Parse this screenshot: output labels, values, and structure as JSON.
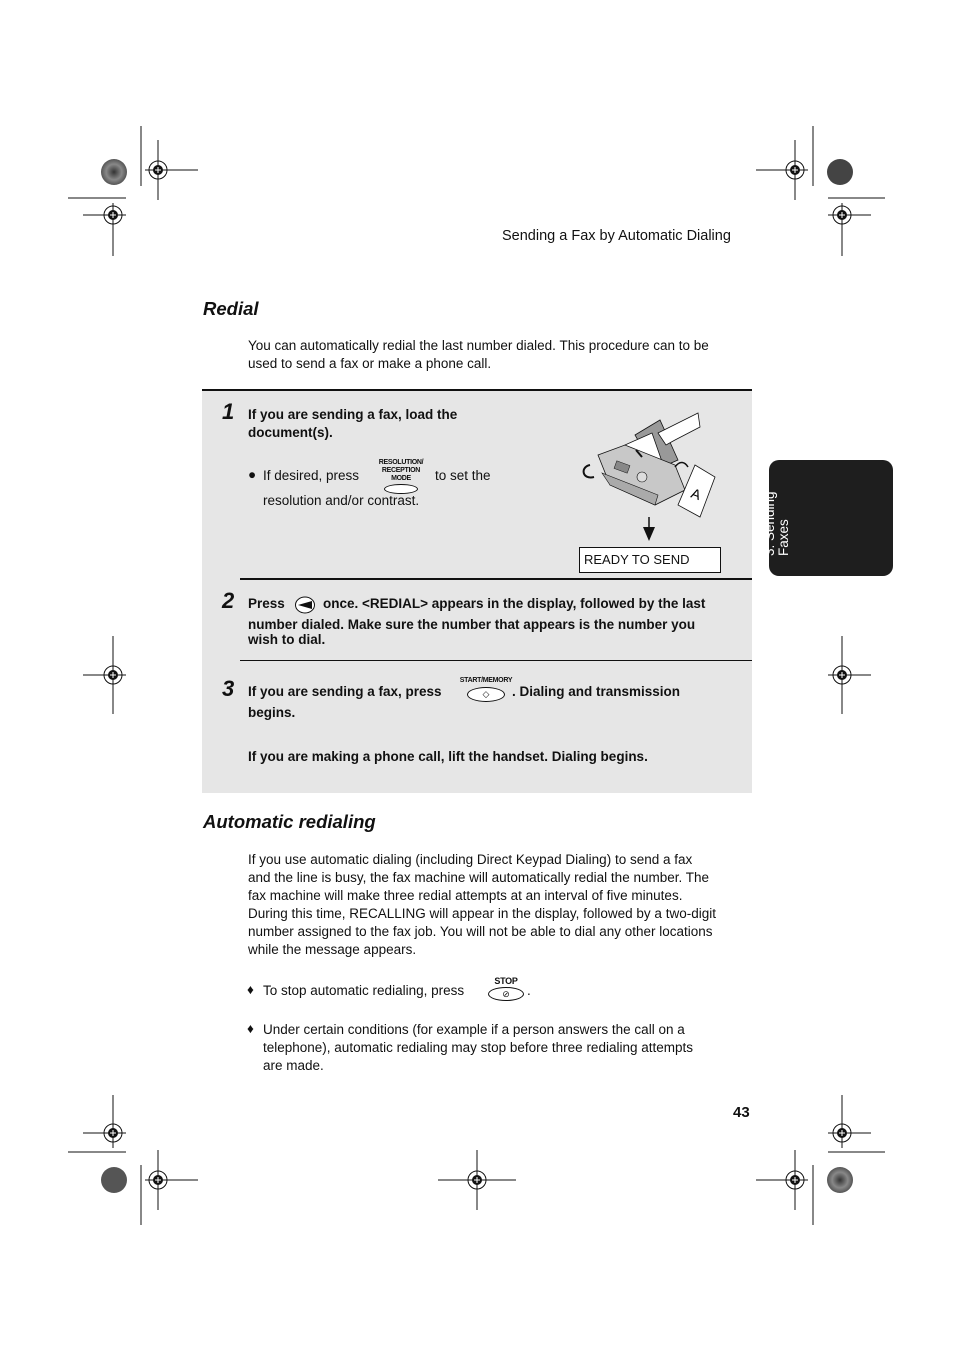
{
  "header": {
    "running_title": "Sending a Fax by Automatic Dialing"
  },
  "redial": {
    "title": "Redial",
    "intro_line1": "You can automatically redial the last number dialed. This procedure can to be",
    "intro_line2": "used to send a fax or make a phone call."
  },
  "steps": [
    {
      "number": "1",
      "line1": "If you are sending a fax, load the",
      "line2": "document(s).",
      "bullet_pre": "If desired, press",
      "button_label_line1": "RESOLUTION/",
      "button_label_line2": "RECEPTION MODE",
      "bullet_post": "to set the",
      "bullet_line2": "resolution and/or contrast.",
      "display_text": "READY TO SEND"
    },
    {
      "number": "2",
      "pre": "Press",
      "post": "once. <REDIAL> appears in the display, followed by the last",
      "line2": "number dialed. Make sure the number that appears is the number you",
      "line3": "wish to dial."
    },
    {
      "number": "3",
      "pre": "If you are sending a fax, press",
      "button_label": "START/MEMORY",
      "post": ". Dialing and transmission",
      "line2": "begins.",
      "line3": "If you are making a phone call, lift the handset. Dialing begins."
    }
  ],
  "auto_redial": {
    "title": "Automatic redialing",
    "paragraph": [
      "If you use automatic dialing (including Direct Keypad Dialing) to send a fax",
      "and the line is busy, the fax machine will automatically redial the number. The",
      "fax machine will make three redial attempts at an interval of five minutes.",
      "During this time, RECALLING will appear in the display, followed by a two-digit",
      "number assigned to the fax job. You will not be able to dial any other locations",
      "while the message appears."
    ],
    "bullet1_pre": "To stop automatic redialing, press",
    "stop_label": "STOP",
    "bullet1_post": ".",
    "bullet2": [
      "Under certain conditions (for example if a person answers the call on a",
      "telephone), automatic redialing may stop before three redialing attempts",
      "are made."
    ],
    "bullet_glyph": "♦"
  },
  "side_tab": {
    "line1": "3. Sending",
    "line2": "Faxes"
  },
  "page_number": "43"
}
